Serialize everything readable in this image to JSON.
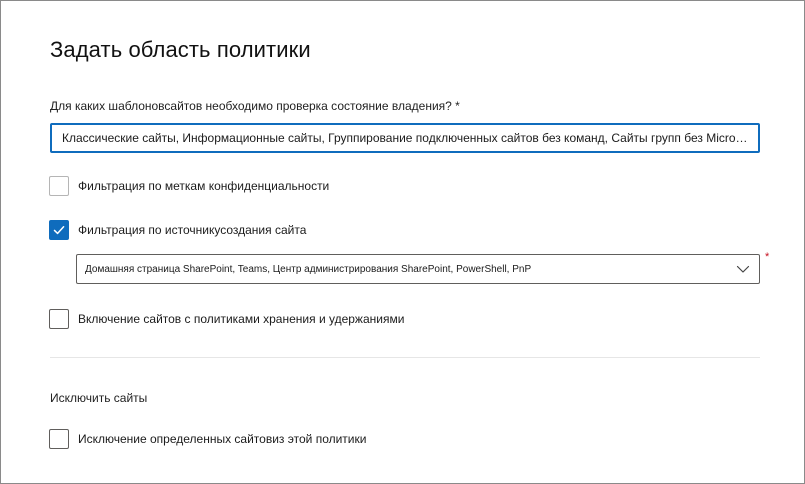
{
  "panel": {
    "title": "Задать область политики"
  },
  "site_templates": {
    "question": "Для каких шаблоновсайтов необходимо проверка состояние владения? *",
    "value": "Классические сайты, Информационные сайты, Группирование подключенных сайтов без команд, Сайты групп без Microsoft 365 ..."
  },
  "filters": {
    "sensitivity_labels": {
      "label": "Фильтрация по меткам конфиденциальности",
      "checked": false
    },
    "creation_source": {
      "label": "Фильтрация по источникусоздания сайта",
      "checked": true
    },
    "creation_source_dropdown": {
      "value": "Домашняя страница SharePoint, Teams, Центр администрирования SharePoint, PowerShell, PnP",
      "required_mark": "*"
    },
    "retention_policies": {
      "label": "Включение сайтов с политиками хранения и удержаниями",
      "checked": false
    }
  },
  "exclude": {
    "section_label": "Исключить сайты",
    "exclude_specific": {
      "label": "Исключение определенных сайтовиз этой политики",
      "checked": false
    }
  },
  "colors": {
    "accent": "#0f6cbd",
    "required": "#c50f1f"
  },
  "icons": {
    "checkmark": "checkmark-icon",
    "dropdown": "chevron-down-icon"
  }
}
